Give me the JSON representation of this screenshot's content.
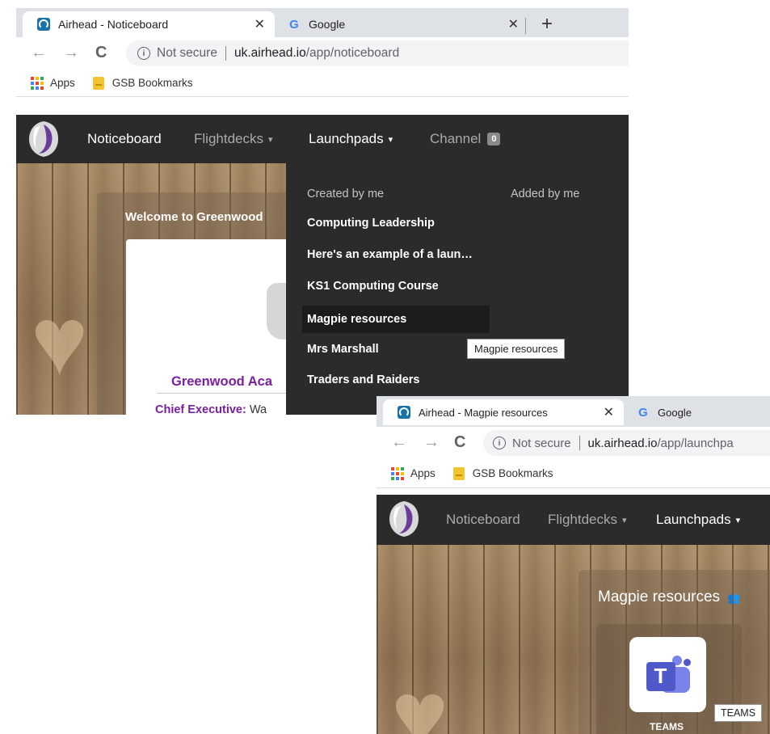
{
  "shot1": {
    "tabs": [
      {
        "title": "Airhead - Noticeboard",
        "favicon": "airhead-icon"
      },
      {
        "title": "Google",
        "favicon": "google-icon"
      }
    ],
    "close_glyph": "✕",
    "new_tab_glyph": "+",
    "address": {
      "security": "Not secure",
      "host": "uk.airhead.io",
      "path": "/app/noticeboard"
    },
    "bookmarks": {
      "apps": "Apps",
      "folder": "GSB Bookmarks"
    },
    "nav": {
      "noticeboard": "Noticeboard",
      "flightdecks": "Flightdecks",
      "launchpads": "Launchpads",
      "channel": "Channel",
      "channel_badge": "0"
    },
    "welcome_title": "Welcome to Greenwood",
    "org_name": "Greenwood Aca",
    "chief_label": "Chief Executive:",
    "chief_value": "Wa",
    "dropdown": {
      "created_header": "Created by me",
      "added_header": "Added by me",
      "items": [
        "Computing Leadership",
        "Here's an example of a laun…",
        "KS1 Computing Course",
        "Magpie resources",
        "Mrs Marshall",
        "Traders and Raiders"
      ],
      "hovered_index": 3
    },
    "tooltip": "Magpie resources"
  },
  "shot2": {
    "tabs": [
      {
        "title": "Airhead - Magpie resources",
        "favicon": "airhead-icon"
      },
      {
        "title": "Google",
        "favicon": "google-icon"
      }
    ],
    "close_glyph": "✕",
    "address": {
      "security": "Not secure",
      "host": "uk.airhead.io",
      "path": "/app/launchpa"
    },
    "bookmarks": {
      "apps": "Apps",
      "folder": "GSB Bookmarks"
    },
    "nav": {
      "noticeboard": "Noticeboard",
      "flightdecks": "Flightdecks",
      "launchpads": "Launchpads"
    },
    "launchpad_title": "Magpie resources",
    "tile_label": "TEAMS",
    "tooltip": "TEAMS"
  },
  "colors": {
    "navbar": "#2b2b2b",
    "org_purple": "#7b1fa2",
    "teams_primary": "#5059c9",
    "teams_secondary": "#7b83eb"
  },
  "icons": [
    "back-arrow-icon",
    "forward-arrow-icon",
    "reload-icon",
    "info-icon",
    "apps-grid-icon",
    "bookmark-folder-icon",
    "airhead-logo-icon",
    "heart-icon",
    "users-icon",
    "teams-icon"
  ]
}
